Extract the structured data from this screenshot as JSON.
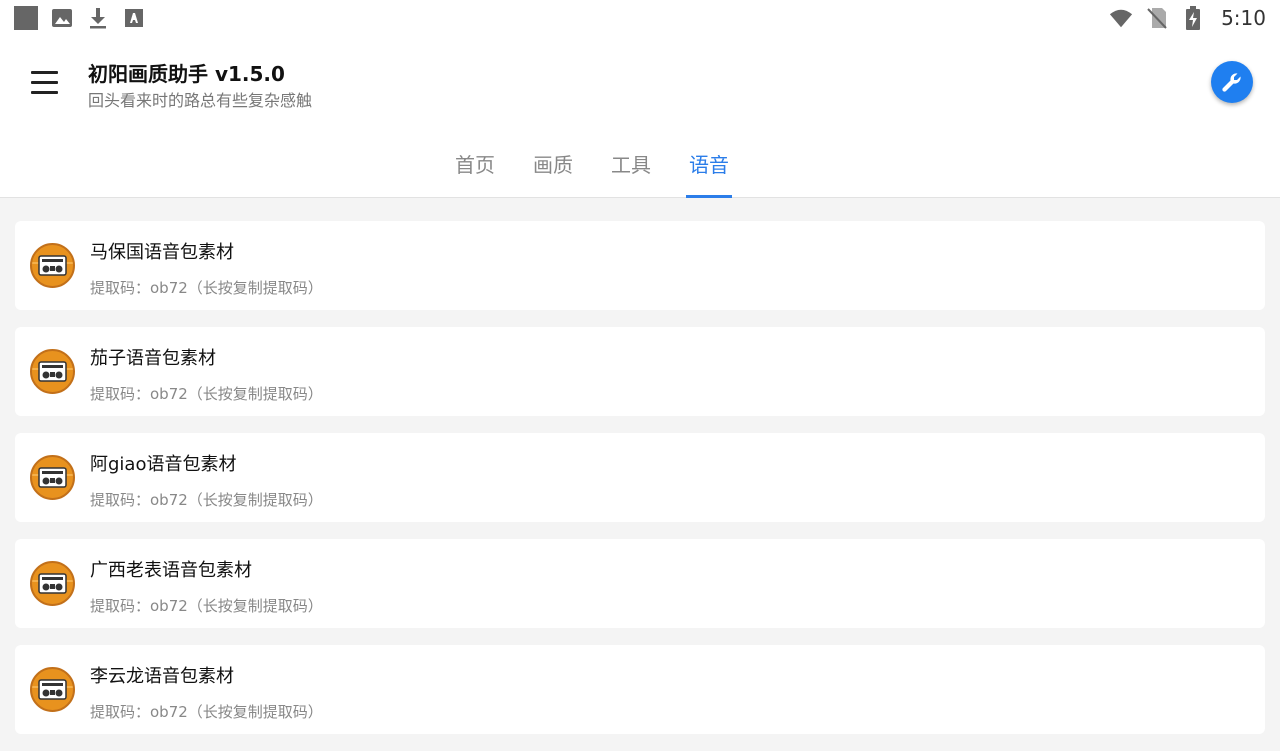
{
  "status_bar": {
    "time": "5:10",
    "left_icons": [
      "app-icon",
      "image-icon",
      "download-icon",
      "text-icon"
    ],
    "right_icons": [
      "wifi-icon",
      "no-sim-icon",
      "battery-charging-icon"
    ]
  },
  "appbar": {
    "title": "初阳画质助手 v1.5.0",
    "subtitle": "回头看来时的路总有些复杂感触",
    "accent": "#1f7ff0"
  },
  "tabs": [
    {
      "label": "首页",
      "active": false
    },
    {
      "label": "画质",
      "active": false
    },
    {
      "label": "工具",
      "active": false
    },
    {
      "label": "语音",
      "active": true
    }
  ],
  "items": [
    {
      "title": "马保国语音包素材",
      "code": "提取码：ob72（长按复制提取码）"
    },
    {
      "title": "茄子语音包素材",
      "code": "提取码：ob72（长按复制提取码）"
    },
    {
      "title": "阿giao语音包素材",
      "code": "提取码：ob72（长按复制提取码）"
    },
    {
      "title": "广西老表语音包素材",
      "code": "提取码：ob72（长按复制提取码）"
    },
    {
      "title": "李云龙语音包素材",
      "code": "提取码：ob72（长按复制提取码）"
    }
  ]
}
